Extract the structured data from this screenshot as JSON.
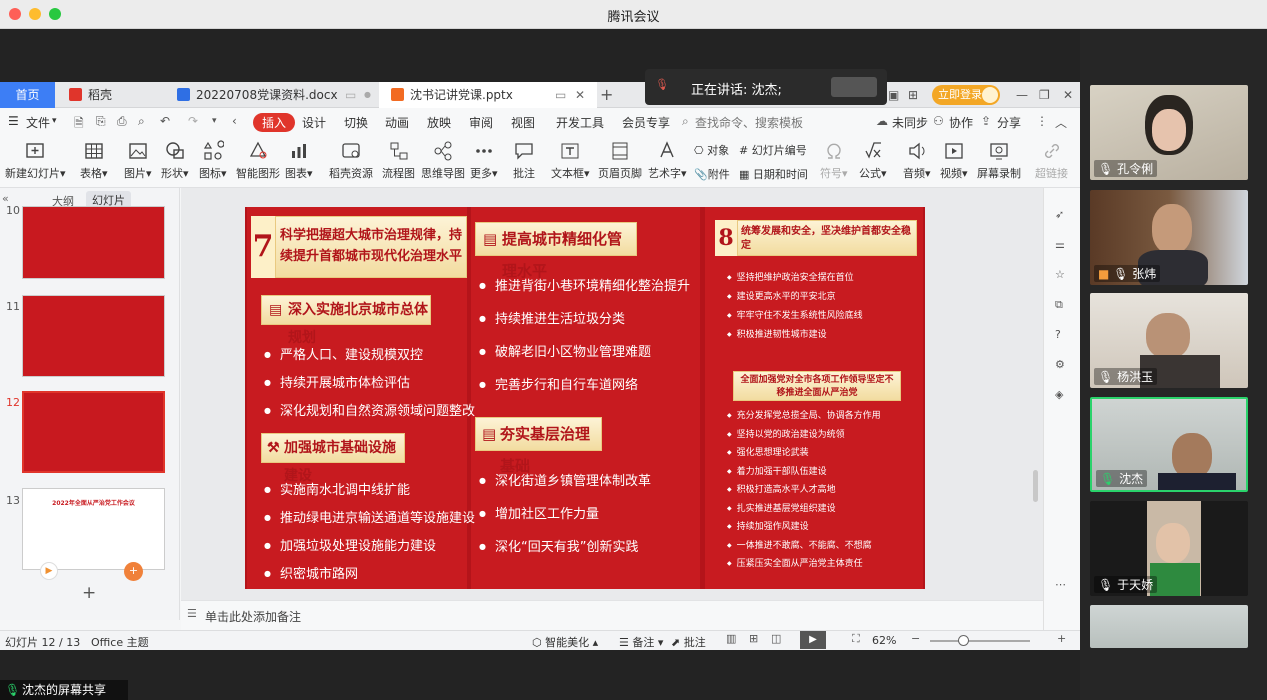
{
  "window": {
    "title": "腾讯会议"
  },
  "speaking": {
    "text": "正在讲话: 沈杰;"
  },
  "tabs": {
    "home": "首页",
    "daoke": "稻壳",
    "docx": "20220708党课资料.docx",
    "pptx": "沈书记讲党课.pptx"
  },
  "menu": {
    "file": "文件",
    "items": [
      "插入",
      "设计",
      "切换",
      "动画",
      "放映",
      "审阅",
      "视图",
      "开发工具",
      "会员专享"
    ],
    "search_placeholder": "查找命令、搜索模板",
    "unsync": "未同步",
    "collab": "协作",
    "share": "分享",
    "login": "立即登录"
  },
  "ribbon": {
    "new_slide": "新建幻灯片",
    "table": "表格",
    "picture": "图片",
    "shape": "形状",
    "icon": "图标",
    "smart_graphic": "智能图形",
    "chart": "图表",
    "daoke_res": "稻壳资源",
    "flowchart": "流程图",
    "mindmap": "思维导图",
    "more": "更多",
    "comment": "批注",
    "textbox": "文本框",
    "header_footer": "页眉页脚",
    "art_text": "艺术字",
    "object": "对象",
    "attachment": "附件",
    "slide_number": "幻灯片编号",
    "date_time": "日期和时间",
    "symbol": "符号",
    "formula": "公式",
    "audio": "音频",
    "video": "视频",
    "screen_record": "屏幕录制",
    "hyperlink": "超链接"
  },
  "panel": {
    "outline": "大纲",
    "slides": "幻灯片",
    "nums": [
      "10",
      "11",
      "12",
      "13"
    ],
    "thumb13_title": "2022年全面从严治党工作会议"
  },
  "slide": {
    "num7": "7",
    "h7": "科学把握超大城市治理规律，持续提升首都城市现代化治理水平",
    "sub1": "深入实施北京城市总体规划",
    "b1": [
      "严格人口、建设规模双控",
      "持续开展城市体检评估",
      "深化规划和自然资源领域问题整改"
    ],
    "sub2": "加强城市基础设施建设",
    "b2": [
      "实施南水北调中线扩能",
      "推动绿电进京输送通道等设施建设",
      "加强垃圾处理设施能力建设",
      "织密城市路网"
    ],
    "h_mid1": "提高城市精细化管理水平",
    "m1": [
      "推进背街小巷环境精细化整治提升",
      "持续推进生活垃圾分类",
      "破解老旧小区物业管理难题",
      "完善步行和自行车道网络"
    ],
    "h_mid2": "夯实基层治理基础",
    "m2": [
      "深化街道乡镇管理体制改革",
      "增加社区工作力量",
      "深化“回天有我”创新实践"
    ],
    "num8": "8",
    "h8": "统筹发展和安全，坚决维护首都安全稳定",
    "r1": [
      "坚持把维护政治安全摆在首位",
      "建设更高水平的平安北京",
      "牢牢守住不发生系统性风险底线",
      "积极推进韧性城市建设"
    ],
    "h_party": "全面加强党对全市各项工作领导坚定不移推进全面从严治党",
    "r2": [
      "充分发挥党总揽全局、协调各方作用",
      "坚持以党的政治建设为统领",
      "强化思想理论武装",
      "着力加强干部队伍建设",
      "积极打造高水平人才高地",
      "扎实推进基层党组织建设",
      "持续加强作风建设",
      "一体推进不敢腐、不能腐、不想腐",
      "压紧压实全面从严治党主体责任"
    ]
  },
  "notes": {
    "placeholder": "单击此处添加备注"
  },
  "status": {
    "slide_pos": "幻灯片 12 / 13",
    "theme": "Office 主题",
    "beautify": "智能美化",
    "notes": "备注",
    "comment": "批注",
    "zoom": "62%"
  },
  "participants": [
    {
      "name": "孔令俐"
    },
    {
      "name": "张炜"
    },
    {
      "name": "杨洪玉"
    },
    {
      "name": "沈杰"
    },
    {
      "name": "于天娇"
    }
  ],
  "share": {
    "text": "沈杰的屏幕共享"
  },
  "colors": {
    "accent": "#3d7ef5",
    "slide_red": "#c81b20",
    "menu_red": "#e0352b",
    "speaking_green": "#2ad36b"
  }
}
